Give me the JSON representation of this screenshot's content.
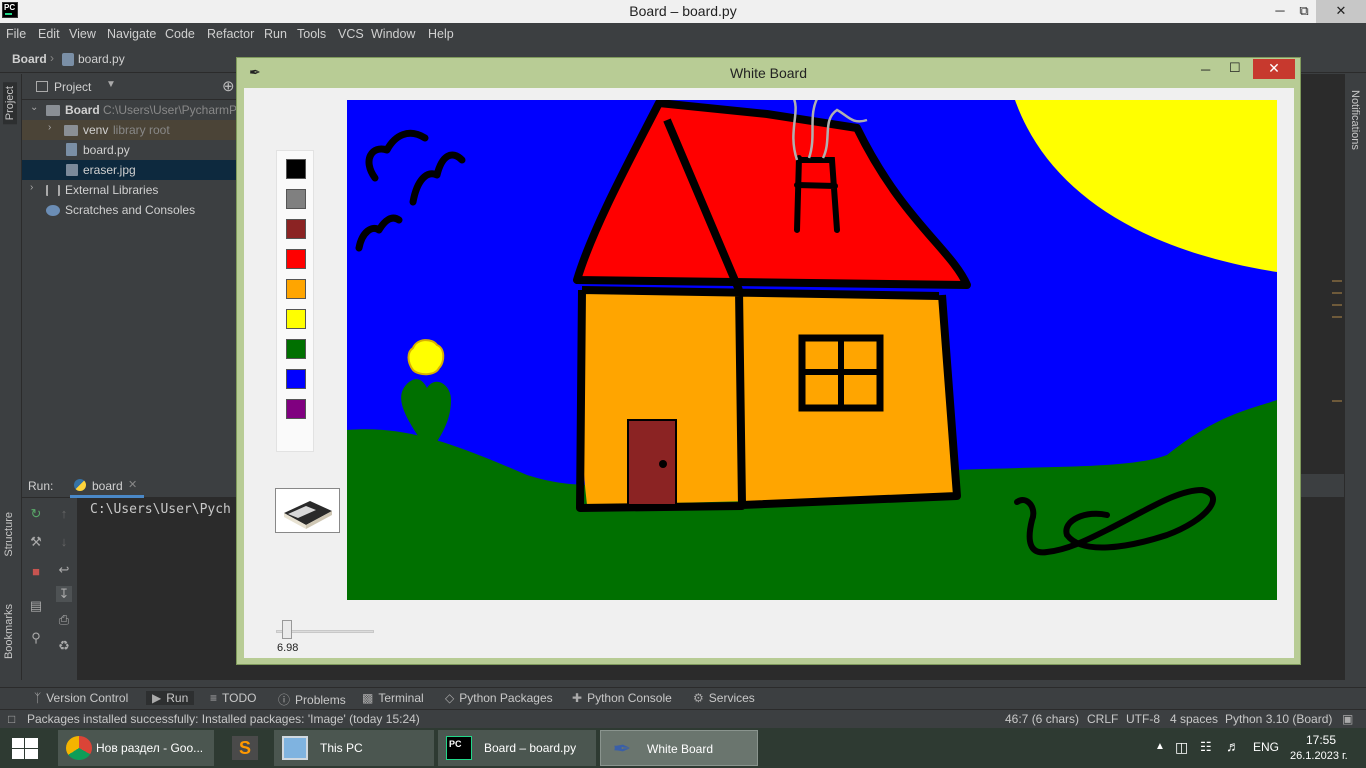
{
  "ide": {
    "title": "Board – board.py",
    "menu": [
      "File",
      "Edit",
      "View",
      "Navigate",
      "Code",
      "Refactor",
      "Run",
      "Tools",
      "VCS",
      "Window",
      "Help"
    ],
    "breadcrumb": {
      "project": "Board",
      "file": "board.py"
    },
    "left_tabs": {
      "project": "Project",
      "structure": "Structure",
      "bookmarks": "Bookmarks"
    },
    "right_tabs": {
      "notifications": "Notifications"
    },
    "project_panel": {
      "title": "Project",
      "tree": [
        {
          "label": "Board",
          "sub": "C:\\Users\\User\\PycharmPr"
        },
        {
          "label": "venv",
          "sub": "library root"
        },
        {
          "label": "board.py",
          "sub": ""
        },
        {
          "label": "eraser.jpg",
          "sub": ""
        },
        {
          "label": "External Libraries",
          "sub": ""
        },
        {
          "label": "Scratches and Consoles",
          "sub": ""
        }
      ]
    },
    "run_panel": {
      "label": "Run:",
      "tab": "board",
      "console": "C:\\Users\\User\\Pych"
    },
    "bottom_tabs": [
      "Version Control",
      "Run",
      "TODO",
      "Problems",
      "Terminal",
      "Python Packages",
      "Python Console",
      "Services"
    ],
    "status": {
      "message": "Packages installed successfully: Installed packages: 'Image' (today 15:24)",
      "position": "46:7 (6 chars)",
      "line_sep": "CRLF",
      "encoding": "UTF-8",
      "indent": "4 spaces",
      "interpreter": "Python 3.10 (Board)"
    }
  },
  "whiteboard": {
    "title": "White Board",
    "palette": [
      "#000000",
      "#808080",
      "#8b2323",
      "#ff0000",
      "#ffa500",
      "#ffff00",
      "#007000",
      "#0000ff",
      "#800080"
    ],
    "slider_value": "6.98",
    "slider_fraction": 0.07,
    "eraser_icon": "eraser-image"
  },
  "taskbar": {
    "items": [
      {
        "label": "Нов раздел - Goo..."
      },
      {
        "label": ""
      },
      {
        "label": "This PC"
      },
      {
        "label": "Board – board.py"
      },
      {
        "label": "White Board"
      }
    ],
    "lang": "ENG",
    "time": "17:55",
    "date": "26.1.2023 г."
  }
}
